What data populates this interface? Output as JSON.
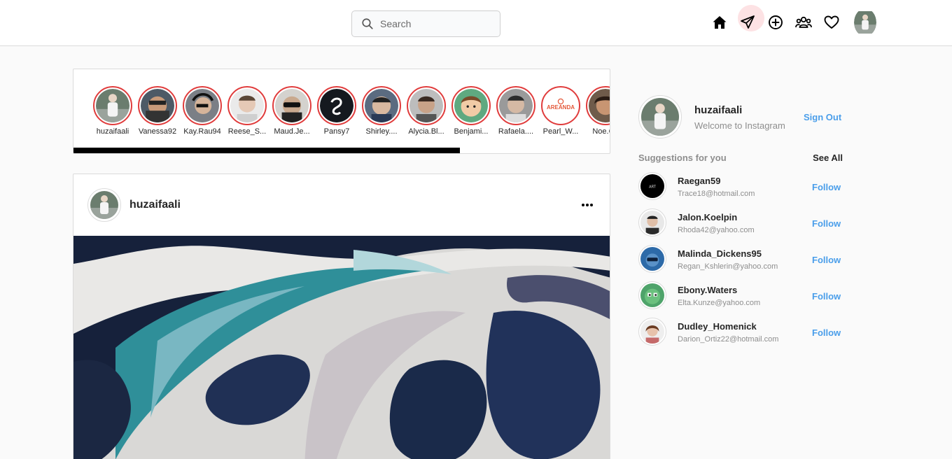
{
  "search": {
    "placeholder": "Search"
  },
  "nav": {
    "icons": [
      "home-icon",
      "paper-plane-icon",
      "plus-circle-icon",
      "people-icon",
      "heart-icon"
    ],
    "highlight_color": "#fde2e4"
  },
  "stories": [
    {
      "name": "huzaifaali"
    },
    {
      "name": "Vanessa92"
    },
    {
      "name": "Kay.Rau94"
    },
    {
      "name": "Reese_S..."
    },
    {
      "name": "Maud.Je..."
    },
    {
      "name": "Pansy7"
    },
    {
      "name": "Shirley...."
    },
    {
      "name": "Alycia.Bl..."
    },
    {
      "name": "Benjami..."
    },
    {
      "name": "Rafaela...."
    },
    {
      "name": "Pearl_W..."
    },
    {
      "name": "Noe.Ca"
    }
  ],
  "story_logo_text": "AREANDA",
  "post": {
    "username": "huzaifaali"
  },
  "profile": {
    "username": "huzaifaali",
    "subtitle": "Welcome to Instagram",
    "sign_out_label": "Sign Out"
  },
  "suggestions": {
    "title": "Suggestions for you",
    "see_all_label": "See All",
    "follow_label": "Follow",
    "items": [
      {
        "name": "Raegan59",
        "email": "Trace18@hotmail.com"
      },
      {
        "name": "Jalon.Koelpin",
        "email": "Rhoda42@yahoo.com"
      },
      {
        "name": "Malinda_Dickens95",
        "email": "Regan_Kshlerin@yahoo.com"
      },
      {
        "name": "Ebony.Waters",
        "email": "Elta.Kunze@yahoo.com"
      },
      {
        "name": "Dudley_Homenick",
        "email": "Darion_Ortiz22@hotmail.com"
      }
    ]
  },
  "colors": {
    "story_ring": "#e03c3c",
    "link_blue": "#4a9eea",
    "muted_text": "#8e8e8e"
  }
}
